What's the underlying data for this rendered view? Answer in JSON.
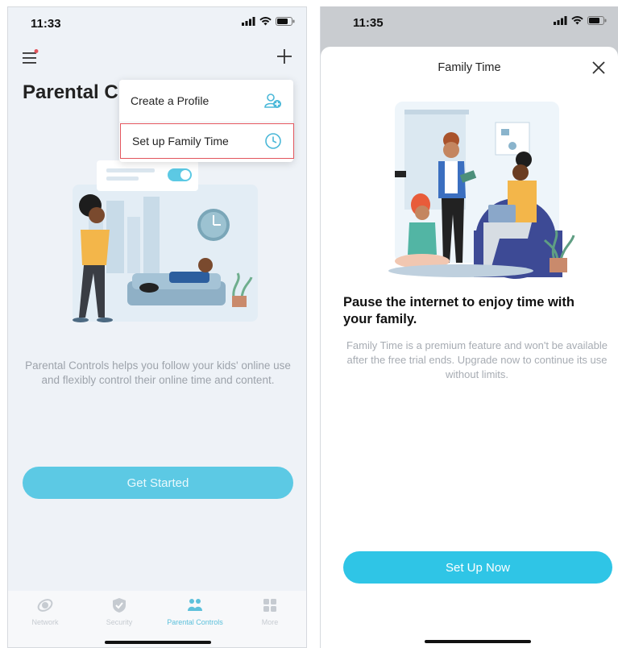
{
  "left_screen": {
    "status_time": "11:33",
    "title": "Parental C",
    "menu": {
      "items": [
        {
          "label": "Create a Profile",
          "icon": "add-profile-icon"
        },
        {
          "label": "Set up Family Time",
          "icon": "clock-icon"
        }
      ],
      "highlighted_index": 1,
      "highlight_color": "#e2555d"
    },
    "description": "Parental Controls helps you follow your kids' online use and flexibly control their online time and content.",
    "button_label": "Get Started",
    "tabs": [
      {
        "label": "Network",
        "icon": "network-icon",
        "active": false
      },
      {
        "label": "Security",
        "icon": "shield-icon",
        "active": false
      },
      {
        "label": "Parental Controls",
        "icon": "family-icon",
        "active": true
      },
      {
        "label": "More",
        "icon": "grid-icon",
        "active": false
      }
    ],
    "accent_color": "#5cc9e4"
  },
  "right_screen": {
    "status_time": "11:35",
    "sheet_title": "Family Time",
    "heading": "Pause the internet to enjoy time with your family.",
    "description": "Family Time is a premium feature and won't be available after the free trial ends. Upgrade now to continue its use without limits.",
    "button_label": "Set Up Now",
    "accent_color": "#2fc5e6"
  }
}
